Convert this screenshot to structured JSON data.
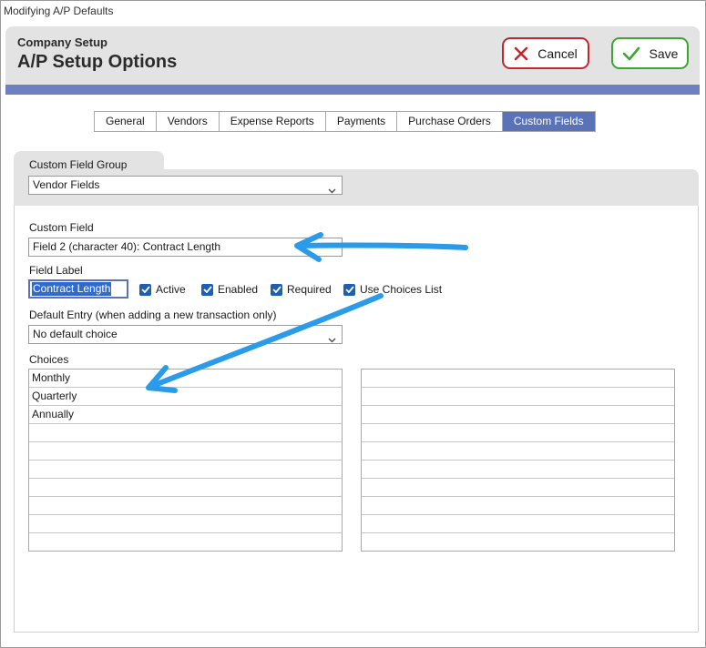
{
  "window": {
    "title": "Modifying A/P Defaults"
  },
  "header": {
    "subtitle": "Company Setup",
    "title": "A/P Setup Options",
    "cancel_label": "Cancel",
    "save_label": "Save"
  },
  "tabs": [
    {
      "label": "General",
      "active": false
    },
    {
      "label": "Vendors",
      "active": false
    },
    {
      "label": "Expense Reports",
      "active": false
    },
    {
      "label": "Payments",
      "active": false
    },
    {
      "label": "Purchase Orders",
      "active": false
    },
    {
      "label": "Custom Fields",
      "active": true
    }
  ],
  "group": {
    "label": "Custom Field Group",
    "selected": "Vendor Fields"
  },
  "custom_field": {
    "label": "Custom Field",
    "selected": "Field 2 (character 40): Contract Length"
  },
  "field_label": {
    "label": "Field Label",
    "value": "Contract Length"
  },
  "checkboxes": {
    "active": "Active",
    "enabled": "Enabled",
    "required": "Required",
    "use_choices": "Use Choices List"
  },
  "default_entry": {
    "label": "Default Entry (when adding a new transaction only)",
    "selected": "No default choice"
  },
  "choices": {
    "label": "Choices",
    "left_rows": [
      "Monthly",
      "Quarterly",
      "Annually",
      "",
      "",
      "",
      "",
      "",
      "",
      ""
    ],
    "right_rows": [
      "",
      "",
      "",
      "",
      "",
      "",
      "",
      "",
      "",
      ""
    ]
  },
  "colors": {
    "accent": "#5a73b8",
    "cancel_border": "#c0282d",
    "save_border": "#3aa830",
    "annotation_arrow": "#2a9bea"
  }
}
